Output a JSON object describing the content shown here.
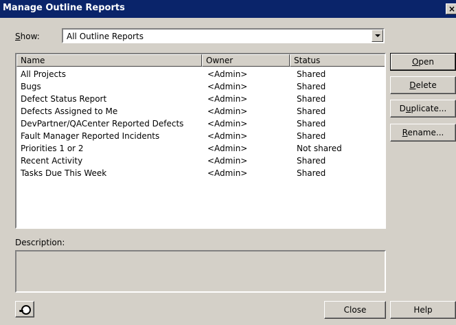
{
  "window": {
    "title": "Manage Outline Reports",
    "close_glyph": "×"
  },
  "show": {
    "label_prefix": "",
    "label_access": "S",
    "label_rest": "how:",
    "value": "All Outline Reports"
  },
  "list": {
    "columns": [
      "Name",
      "Owner",
      "Status"
    ],
    "rows": [
      {
        "name": "All Projects",
        "owner": "<Admin>",
        "status": "Shared"
      },
      {
        "name": "Bugs",
        "owner": "<Admin>",
        "status": "Shared"
      },
      {
        "name": "Defect Status Report",
        "owner": "<Admin>",
        "status": "Shared"
      },
      {
        "name": "Defects Assigned to Me",
        "owner": "<Admin>",
        "status": "Shared"
      },
      {
        "name": "DevPartner/QACenter Reported Defects",
        "owner": "<Admin>",
        "status": "Shared"
      },
      {
        "name": "Fault Manager Reported Incidents",
        "owner": "<Admin>",
        "status": "Shared"
      },
      {
        "name": "Priorities 1 or 2",
        "owner": "<Admin>",
        "status": "Not shared"
      },
      {
        "name": "Recent Activity",
        "owner": "<Admin>",
        "status": "Shared"
      },
      {
        "name": "Tasks Due This Week",
        "owner": "<Admin>",
        "status": "Shared"
      }
    ]
  },
  "description": {
    "label": "Description:",
    "value": ""
  },
  "buttons": {
    "open": {
      "pre": "",
      "key": "O",
      "post": "pen"
    },
    "delete": {
      "pre": "",
      "key": "D",
      "post": "elete"
    },
    "duplicate": {
      "pre": "D",
      "key": "u",
      "post": "plicate..."
    },
    "rename": {
      "pre": "",
      "key": "R",
      "post": "ename..."
    },
    "close": "Close",
    "help": "Help"
  },
  "icons": {
    "help_context": "help-hat-icon"
  }
}
